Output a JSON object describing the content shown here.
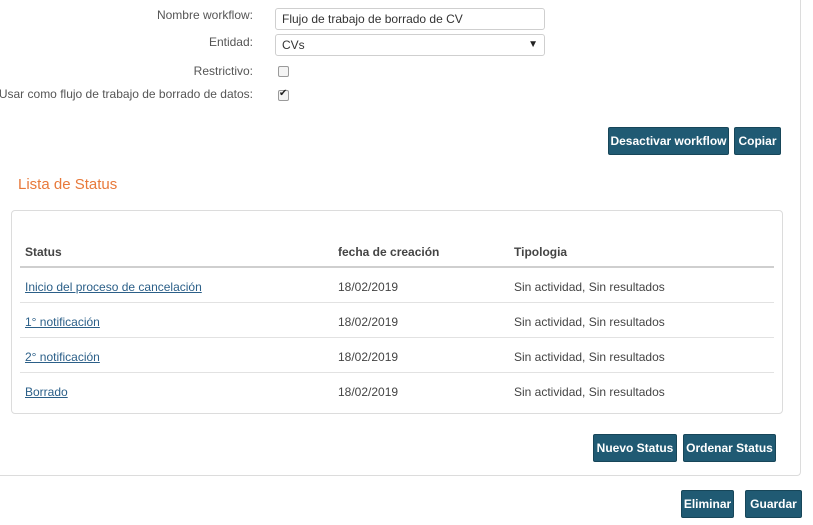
{
  "form": {
    "workflow_name_label": "Nombre workflow:",
    "workflow_name_value": "Flujo de trabajo de borrado de CV",
    "entity_label": "Entidad:",
    "entity_value": "CVs",
    "restrictive_label": "Restrictivo:",
    "restrictive_checked": false,
    "use_as_deletion_label": "Usar como flujo de trabajo de borrado de datos:",
    "use_as_deletion_checked": true
  },
  "actions": {
    "deactivate_label": "Desactivar workflow",
    "copy_label": "Copiar"
  },
  "status_list": {
    "title": "Lista de Status",
    "columns": [
      "Status",
      "fecha de creación",
      "Tipologia"
    ],
    "rows": [
      {
        "status": "Inicio del proceso de cancelación",
        "date": "18/02/2019",
        "type": "Sin actividad, Sin resultados"
      },
      {
        "status": "1° notificación",
        "date": "18/02/2019",
        "type": "Sin actividad, Sin resultados"
      },
      {
        "status": "2° notificación",
        "date": "18/02/2019",
        "type": "Sin actividad, Sin resultados"
      },
      {
        "status": "Borrado",
        "date": "18/02/2019",
        "type": "Sin actividad, Sin resultados"
      }
    ],
    "new_status_label": "Nuevo Status",
    "order_status_label": "Ordenar Status"
  },
  "footer": {
    "delete_label": "Eliminar",
    "save_label": "Guardar"
  }
}
